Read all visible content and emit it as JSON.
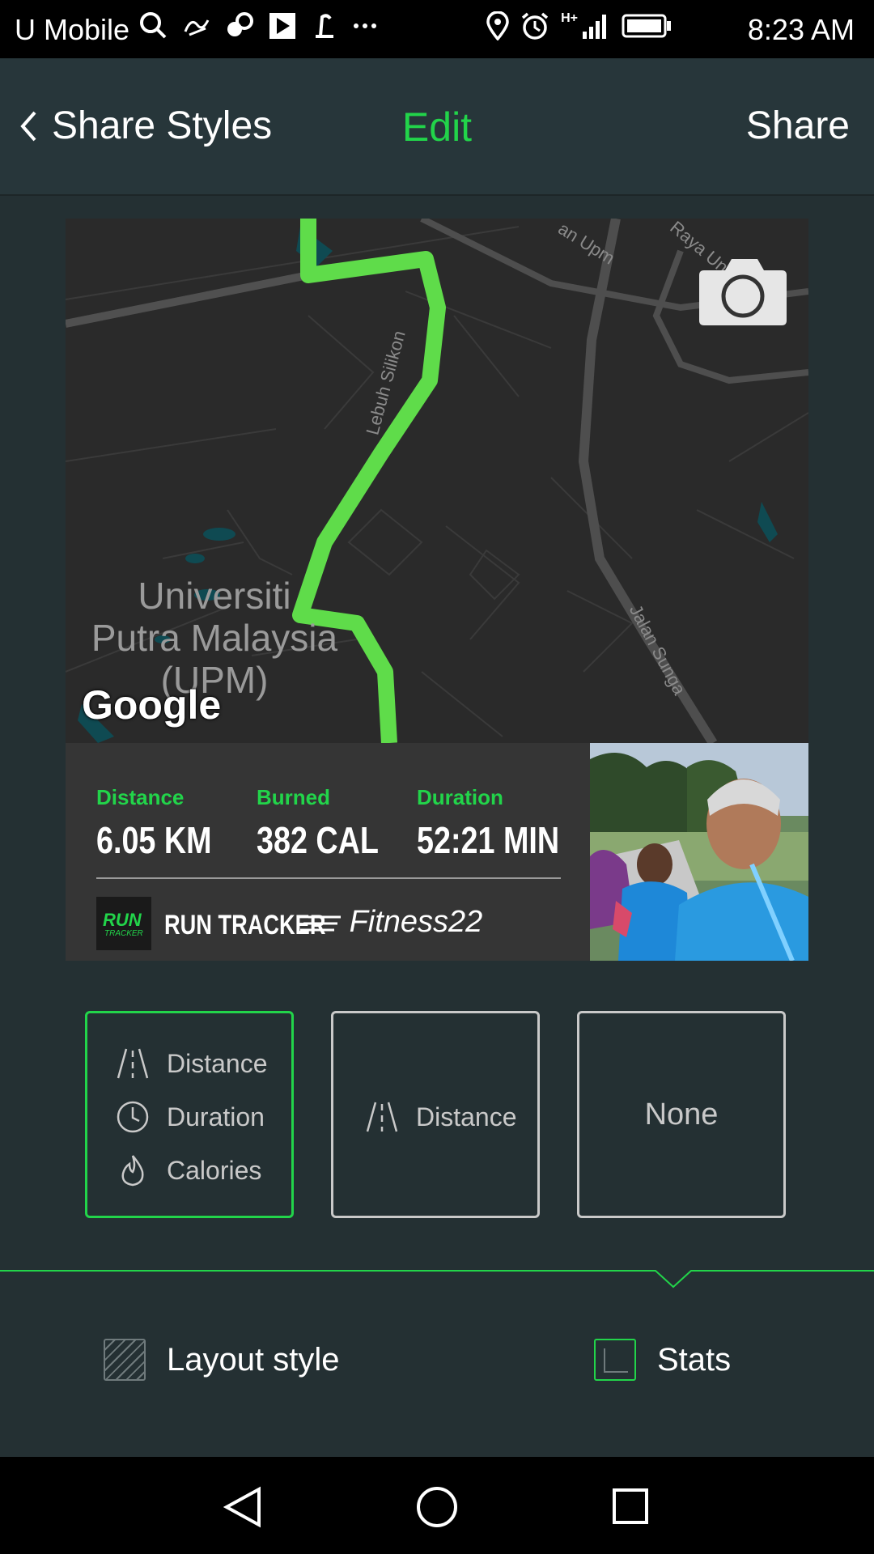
{
  "status_bar": {
    "carrier": "U Mobile",
    "time": "8:23 AM",
    "left_icons": [
      "search-icon",
      "app-icon",
      "squirrel-icon",
      "play-store-icon",
      "app-icon-2",
      "more-icon"
    ],
    "right_icons": [
      "location-icon",
      "alarm-icon",
      "signal-icon",
      "battery-icon"
    ],
    "network_label": "H+"
  },
  "header": {
    "back_label": "Share Styles",
    "title": "Edit",
    "share_label": "Share"
  },
  "map": {
    "place_label_lines": [
      "Universiti",
      "Putra Malaysia",
      "(UPM)"
    ],
    "road_labels": [
      "Lebuh Silikon",
      "Jalan Sunga",
      "an Upm",
      "Raya Uni Selatan"
    ],
    "attribution": "Google",
    "route_color": "#5fdc4a"
  },
  "stats": [
    {
      "label": "Distance",
      "value": "6.05 KM"
    },
    {
      "label": "Burned",
      "value": "382 CAL"
    },
    {
      "label": "Duration",
      "value": "52:21 MIN"
    }
  ],
  "brand": {
    "logo_run": "RUN",
    "logo_tracker": "TRACKER",
    "name": "RUN TRACKER",
    "publisher": "Fitness22"
  },
  "options": [
    {
      "items": [
        {
          "icon": "road-icon",
          "label": "Distance"
        },
        {
          "icon": "clock-icon",
          "label": "Duration"
        },
        {
          "icon": "flame-icon",
          "label": "Calories"
        }
      ],
      "selected": true
    },
    {
      "items": [
        {
          "icon": "road-icon",
          "label": "Distance"
        }
      ],
      "selected": false
    },
    {
      "label": "None",
      "selected": false
    }
  ],
  "tabs": {
    "layout_label": "Layout style",
    "stats_label": "Stats"
  },
  "colors": {
    "accent": "#22d44a",
    "background": "#243033",
    "header": "#27363a"
  }
}
